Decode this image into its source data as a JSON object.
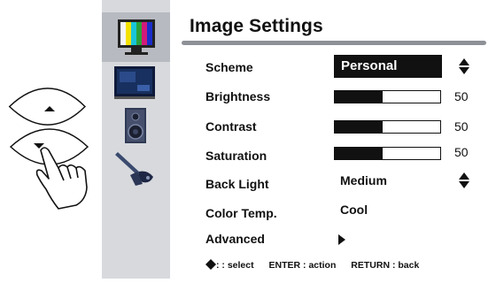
{
  "title": "Image Settings",
  "rows": [
    {
      "label": "Scheme",
      "value": "Personal"
    },
    {
      "label": "Brightness",
      "value": 50
    },
    {
      "label": "Contrast",
      "value": 50
    },
    {
      "label": "Saturation",
      "value": 50
    },
    {
      "label": "Back Light",
      "value": "Medium"
    },
    {
      "label": "Color Temp.",
      "value": "Cool"
    },
    {
      "label": "Advanced",
      "value": ""
    }
  ],
  "bars": [
    {
      "name": "brightness",
      "level": 0.45,
      "number": "50"
    },
    {
      "name": "contrast",
      "level": 0.45,
      "number": "50"
    },
    {
      "name": "saturation",
      "level": 0.45,
      "number": "50"
    }
  ],
  "footer": {
    "select": ": : select",
    "enter": "ENTER : action",
    "return": "RETURN : back"
  },
  "sidebar_icons": [
    "tv-color-bars-icon",
    "screen-icon",
    "speaker-icon",
    "tools-icon"
  ],
  "colors": {
    "sidebar": "#d7d9dd",
    "active_tab": "#b7bac0",
    "rule": "#8e9297",
    "ink": "#111111"
  }
}
